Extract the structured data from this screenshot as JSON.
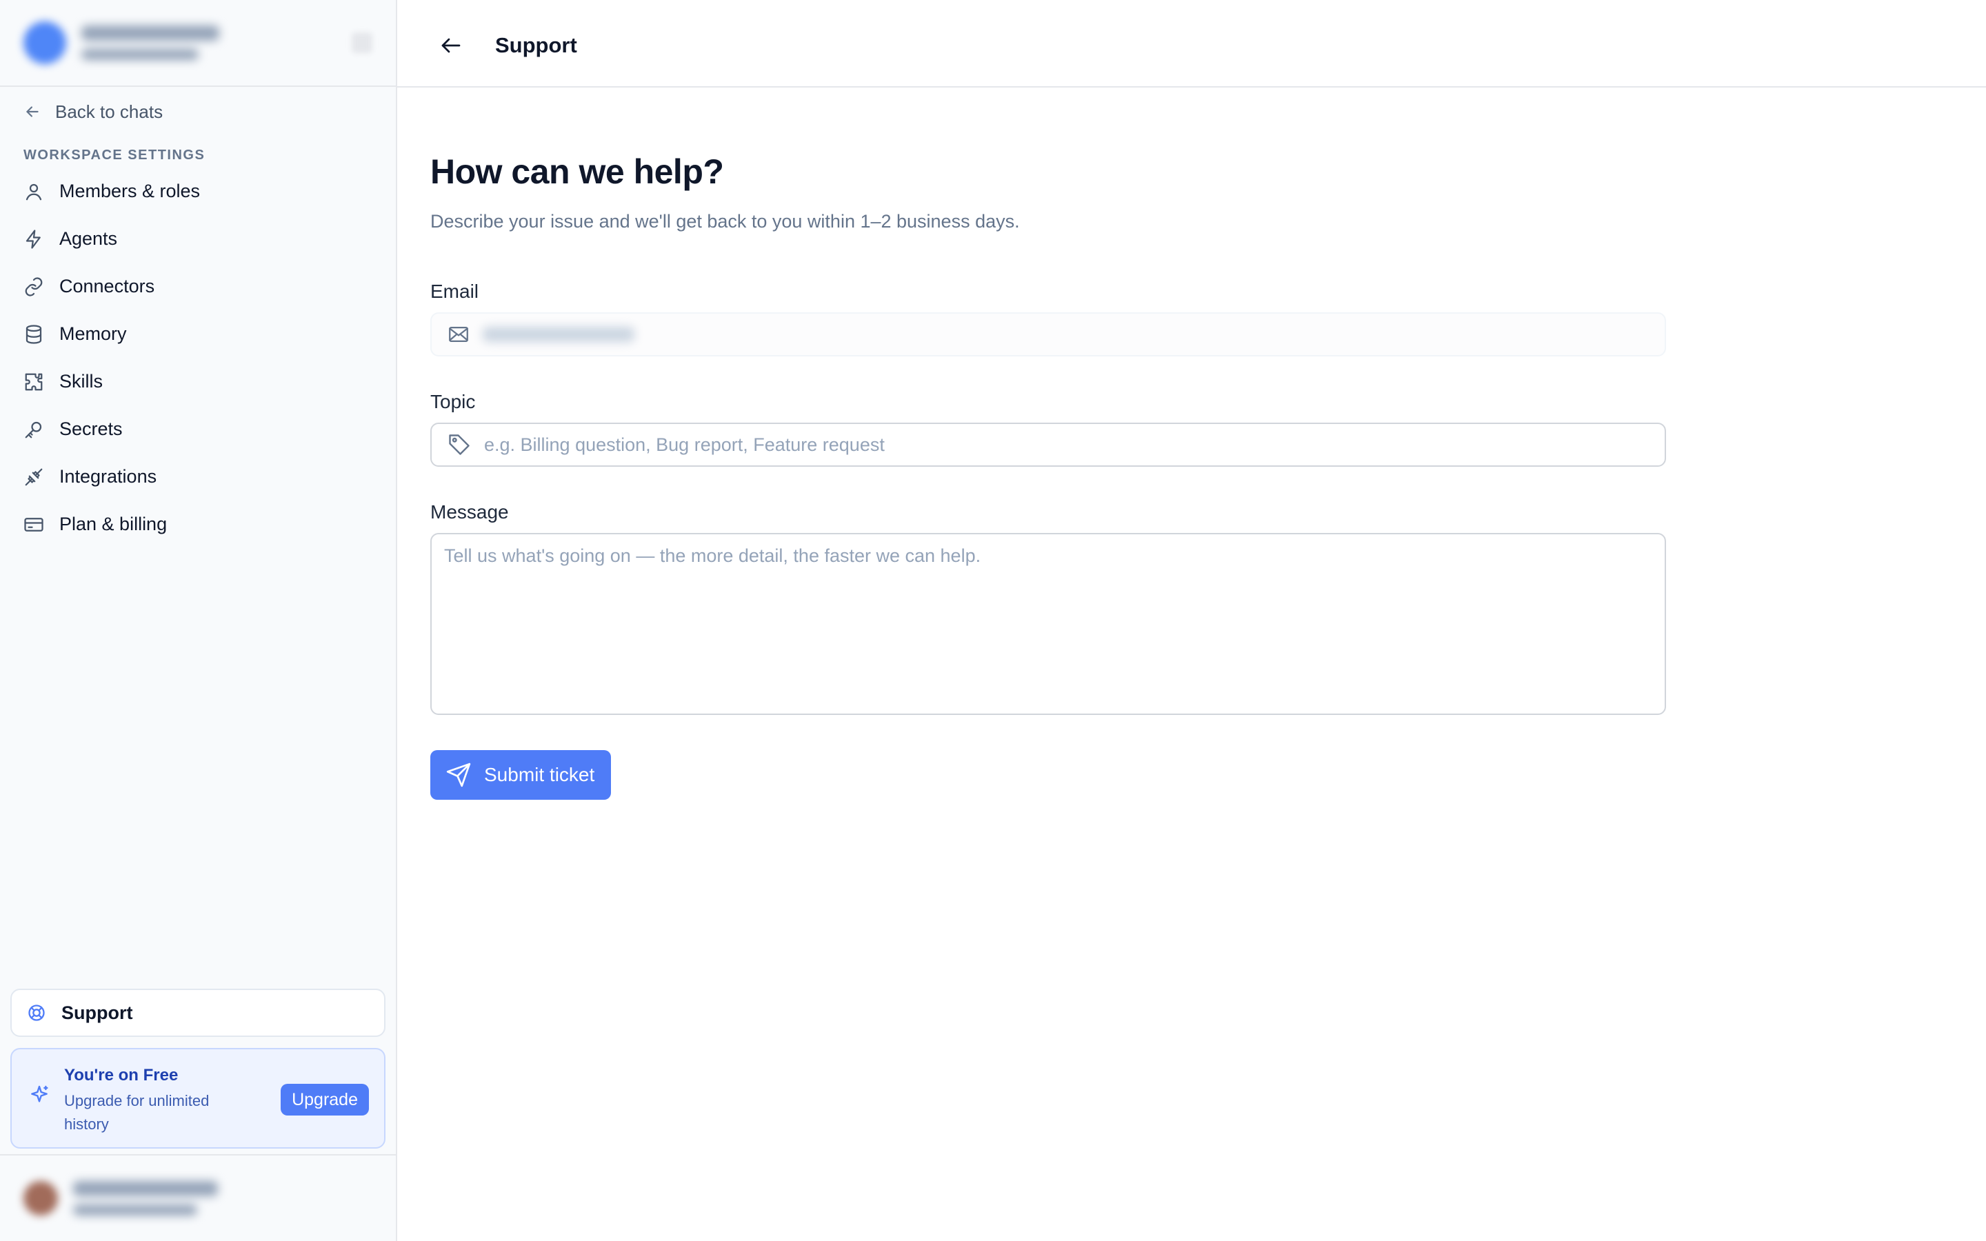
{
  "workspace": {
    "name_blurred": true
  },
  "sidebar": {
    "back_label": "Back to chats",
    "section_label": "WORKSPACE SETTINGS",
    "items": [
      {
        "label": "Members & roles",
        "icon": "user-icon"
      },
      {
        "label": "Agents",
        "icon": "lightning-icon"
      },
      {
        "label": "Connectors",
        "icon": "link-icon"
      },
      {
        "label": "Memory",
        "icon": "database-icon"
      },
      {
        "label": "Skills",
        "icon": "puzzle-icon"
      },
      {
        "label": "Secrets",
        "icon": "key-icon"
      },
      {
        "label": "Integrations",
        "icon": "plug-icon"
      },
      {
        "label": "Plan & billing",
        "icon": "credit-card-icon"
      }
    ],
    "support_label": "Support",
    "upgrade": {
      "title": "You're on Free",
      "subtitle": "Upgrade for unlimited history",
      "button": "Upgrade"
    }
  },
  "header": {
    "title": "Support"
  },
  "form": {
    "heading": "How can we help?",
    "subheading": "Describe your issue and we'll get back to you within 1–2 business days.",
    "email_label": "Email",
    "topic_label": "Topic",
    "topic_placeholder": "e.g. Billing question, Bug report, Feature request",
    "message_label": "Message",
    "message_placeholder": "Tell us what's going on — the more detail, the faster we can help.",
    "submit_label": "Submit ticket"
  },
  "colors": {
    "accent": "#4f7cf7",
    "sidebar_bg": "#f8fafc",
    "upgrade_bg": "#eef3ff",
    "text_primary": "#0f172a",
    "text_muted": "#64748b"
  }
}
